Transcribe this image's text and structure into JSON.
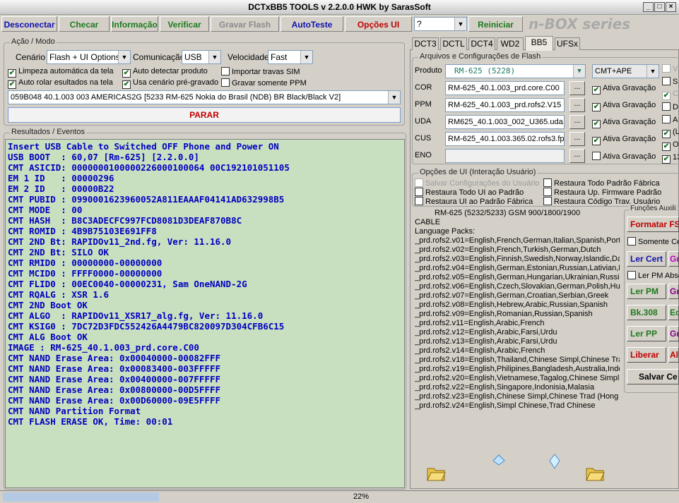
{
  "title": "DCTxBB5 TOOLS v 2.2.0.0 HWK by SarasSoft",
  "window": {
    "min": "_",
    "max": "□",
    "close": "×"
  },
  "toolbar": {
    "desconectar": "Desconectar",
    "checar": "Checar",
    "informacao": "Informação",
    "verificar": "Verificar",
    "gravar_flash": "Gravar Flash",
    "autoteste": "AutoTeste",
    "opcoes_ui": "Opções UI",
    "help_select": "?",
    "reiniciar": "Reiniciar",
    "brand": "n-BOX series"
  },
  "acao": {
    "legend": "Ação / Modo",
    "cenario_label": "Cenário",
    "cenario_value": "Flash + UI Options",
    "comunicacao_label": "Comunicação",
    "comunicacao_value": "USB",
    "velocidade_label": "Velocidade",
    "velocidade_value": "Fast",
    "checks": {
      "limpeza": "Limpeza automática da tela",
      "auto_detectar": "Auto detectar produto",
      "importar": "Importar travas SIM",
      "auto_rolar": "Auto rolar esultados na tela",
      "usa_cenario": "Usa cenário pré-gravado",
      "gravar_ppm": "Gravar somente PPM"
    },
    "product_line": "059B048 40.1.003 003 AMERICAS2G [5233 RM-625 Nokia do Brasil (NDB) BR Black/Black V2]",
    "parar": "PARAR"
  },
  "log": {
    "legend": "Resultados / Eventos",
    "lines": [
      "Insert USB Cable to Switched OFF Phone and Power ON",
      "USB BOOT  : 60,07 [Rm-625] [2.2.0.0]",
      "CMT ASICID: 0000000100000226000100064 00C192101051105",
      "EM 1 ID   : 00000296",
      "EM 2 ID   : 00000B22",
      "CMT PUBID : 0990001623960052A811EAAAF04141AD632998B5",
      "CMT MODE  : 00",
      "CMT HASH  : B8C3ADECFC997FCD8081D3DEAF870B8C",
      "CMT ROMID : 4B9B75103E691FF8",
      "CMT 2ND Bt: RAPIDOv11_2nd.fg, Ver: 11.16.0",
      "CMT 2ND Bt: SILO OK",
      "CMT RMID0 : 00000000-00000000",
      "CMT MCID0 : FFFF0000-00000000",
      "CMT FLID0 : 00EC0040-00000231, Sam OneNAND-2G",
      "CMT RQALG : XSR 1.6",
      "CMT 2ND Boot OK",
      "CMT ALGO  : RAPIDOv11_XSR17_alg.fg, Ver: 11.16.0",
      "CMT KSIG0 : 7DC72D3FDC552426A4479BC820097D304CFB6C15",
      "CMT ALG Boot OK",
      "IMAGE : RM-625_40.1.003_prd.core.C00",
      "CMT NAND Erase Area: 0x00040000-00082FFF",
      "CMT NAND Erase Area: 0x00083400-003FFFFF",
      "CMT NAND Erase Area: 0x00400000-007FFFFF",
      "CMT NAND Erase Area: 0x00800000-00D5FFFF",
      "CMT NAND Erase Area: 0x00D60000-09E5FFFF",
      "CMT NAND Partition Format",
      "CMT FLASH ERASE OK, Time: 00:01"
    ]
  },
  "tabs": [
    "DCT3",
    "DCTL",
    "DCT4",
    "WD2",
    "BB5",
    "UFSx"
  ],
  "flash": {
    "legend": "Arquivos e Configurações de Flash",
    "produto_label": "Produto",
    "produto_value": "RM-625  (5228)",
    "cmt_value": "CMT+APE",
    "rows": [
      {
        "label": "COR",
        "file": "RM-625_40.1.003_prd.core.C00",
        "btn": "...",
        "ativa": "Ativa Gravação"
      },
      {
        "label": "PPM",
        "file": "RM-625_40.1.003_prd.rofs2.V15",
        "btn": "...",
        "ativa": "Ativa Gravação"
      },
      {
        "label": "UDA",
        "file": "RM625_40.1.003_002_U365.uda.",
        "btn": "...",
        "ativa": "Ativa Gravação"
      },
      {
        "label": "CUS",
        "file": "RM-625_40.1.003.365.02.rofs3.fp",
        "btn": "...",
        "ativa": "Ativa Gravação"
      },
      {
        "label": "ENO",
        "file": "",
        "btn": "...",
        "ativa": "Ativa Gravação"
      }
    ],
    "side": [
      "V",
      "S",
      "C",
      "D",
      "A",
      "(L",
      "O",
      "13"
    ]
  },
  "ui_opts": {
    "legend": "Opções de UI (Interação Usuário)",
    "salvar": "Salvar Configurações do Usuário",
    "rest_todo_ui": "Restaura Todo UI ao Padrão",
    "rest_ui": "Restaura UI ao Padrão Fábrica",
    "rest_todo_fab": "Restaura Todo Padrão Fábrica",
    "rest_up": "Restaura Up. Firmware Padrão",
    "rest_cod": "Restaura Código Trav. Usuário"
  },
  "info": {
    "lines": [
      "RM-625 (5232/5233) GSM 900/1800/1900",
      "CABLE",
      "Language Packs:",
      "_prd.rofs2.v01=English,French,German,Italian,Spanish,Portug",
      "_prd.rofs2.v02=English,French,Turkish,German,Dutch",
      "_prd.rofs2.v03=English,Finnish,Swedish,Norway,Islandic,Dar",
      "_prd.rofs2.v04=English,German,Estonian,Russian,Lativian,Lit",
      "_prd.rofs2.v05=English,German,Hungarian,Ukrainian,Russian",
      "_prd.rofs2.v06=English,Czech,Slovakian,German,Polish,Hung",
      "_prd.rofs2.v07=English,German,Croatian,Serbian,Greek",
      "_prd.rofs2.v08=English,Hebrew,Arabic,Russian,Spanish",
      "_prd.rofs2.v09=English,Romanian,Russian,Spanish",
      "_prd.rofs2.v11=English,Arabic,French",
      "_prd.rofs2.v12=English,Arabic,Farsi,Urdu",
      "_prd.rofs2.v13=English,Arabic,Farsi,Urdu",
      "_prd.rofs2.v14=English,Arabic,French",
      "_prd.rofs2.v18=English,Thailand,Chinese Simpl,Chinese Trad",
      "_prd.rofs2.v19=English,Philipines,Bangladesh,Australia,Indon",
      "_prd.rofs2.v20=English,Vietnamese,Tagalog,Chinese Simpl,C",
      "_prd.rofs2.v22=English,Singapore,Indonisia,Malasia",
      "_prd.rofs2.v23=English,Chinese Simpl,Chinese Trad (Hong K",
      "_prd.rofs2.v24=English,Simpl Chinese,Trad Chinese"
    ]
  },
  "funcoes": {
    "legend": "Funções Auxili",
    "formatar": "Formatar FS",
    "somente": "Somente Ce",
    "ler_cert": "Ler Cert",
    "gr1": "Gr",
    "ler_pm_abs": "Ler PM Abso",
    "ler_pm": "Ler PM",
    "gr2": "Gr",
    "bk308": "Bk.308",
    "ed": "Ed",
    "ler_pp": "Ler PP",
    "gr3": "Gr",
    "liberar": "Liberar",
    "al": "Al",
    "salvar": "Salvar Ce"
  },
  "status": {
    "progress": 0.22,
    "percent": "22%"
  },
  "colors": {
    "green": "#1e7a1e",
    "blue": "#1010b0",
    "red": "#c00000",
    "gray": "#8a8a8a",
    "log_bg": "#c8dfc0",
    "log_text": "#0000c0"
  }
}
